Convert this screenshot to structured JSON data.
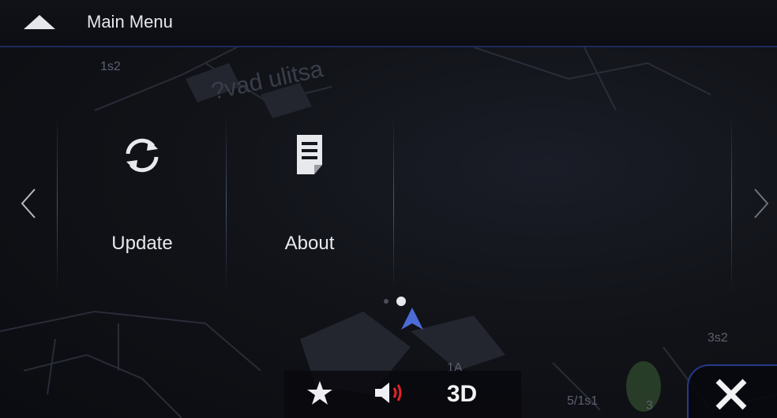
{
  "header": {
    "title": "Main Menu",
    "back_icon": "chevron-up-icon"
  },
  "menu": {
    "items": [
      {
        "label": "Update",
        "icon": "refresh-icon"
      },
      {
        "label": "About",
        "icon": "document-icon"
      }
    ],
    "prev_icon": "chevron-left-icon",
    "next_icon": "chevron-right-icon",
    "page_count": 2,
    "active_page": 2
  },
  "map": {
    "labels": {
      "top_left": "1s2",
      "street": "?vad ulitsa",
      "right": "3s2",
      "bottom_center": "1A",
      "bottom_address": "5/1s1",
      "bottom_number": "3"
    }
  },
  "toolbar": {
    "favorites_icon": "star-icon",
    "volume_icon": "speaker-icon",
    "view_mode_label": "3D",
    "close_icon": "close-icon"
  },
  "colors": {
    "accent_blue": "#253a8c",
    "volume_red": "#e0242a",
    "position_marker": "#4d6bd6"
  }
}
